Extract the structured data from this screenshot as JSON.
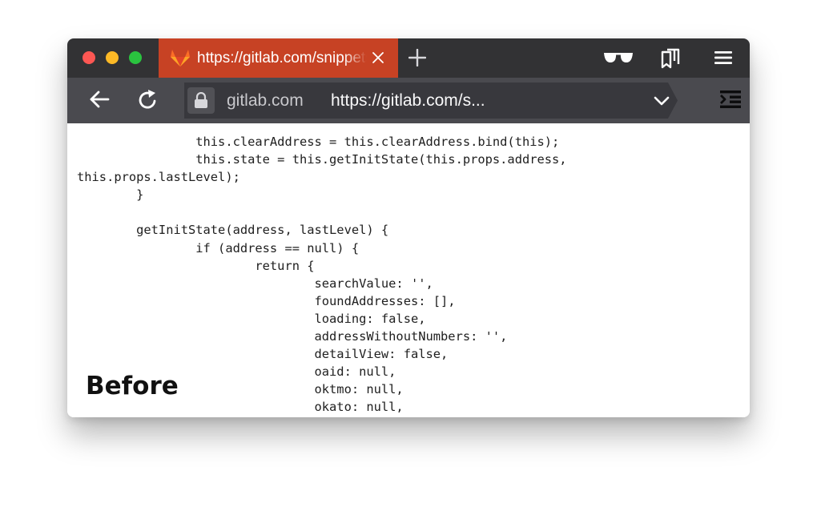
{
  "tab": {
    "title": "https://gitlab.com/snippets/",
    "icon": "gitlab-fox-icon",
    "close_icon": "close-icon"
  },
  "toolbar": {
    "new_tab_icon": "plus-icon",
    "reader_icon": "glasses-icon",
    "library_icon": "library-icon",
    "menu_icon": "hamburger-menu-icon"
  },
  "navigation": {
    "back_icon": "back-arrow-icon",
    "reload_icon": "reload-icon",
    "lock_icon": "lock-icon",
    "domain": "gitlab.com",
    "url": "https://gitlab.com/s...",
    "dropdown_icon": "chevron-down-icon",
    "sidebar_icon": "sidebar-icon"
  },
  "code_lines": [
    "                this.clearAddress = this.clearAddress.bind(this);",
    "                this.state = this.getInitState(this.props.address,",
    "this.props.lastLevel);",
    "        }",
    "",
    "        getInitState(address, lastLevel) {",
    "                if (address == null) {",
    "                        return {",
    "                                searchValue: '',",
    "                                foundAddresses: [],",
    "                                loading: false,",
    "                                addressWithoutNumbers: '',",
    "                                detailView: false,",
    "                                oaid: null,",
    "                                oktmo: null,",
    "                                okato: null,"
  ],
  "caption": "Before",
  "colors": {
    "tab_bar": "#323234",
    "active_tab": "#c74224",
    "nav_bar": "#4a4a4f",
    "url_bar": "#38383d",
    "close_dot": "#fd5753",
    "minimize_dot": "#fdb926",
    "zoom_dot": "#2ac33f"
  }
}
